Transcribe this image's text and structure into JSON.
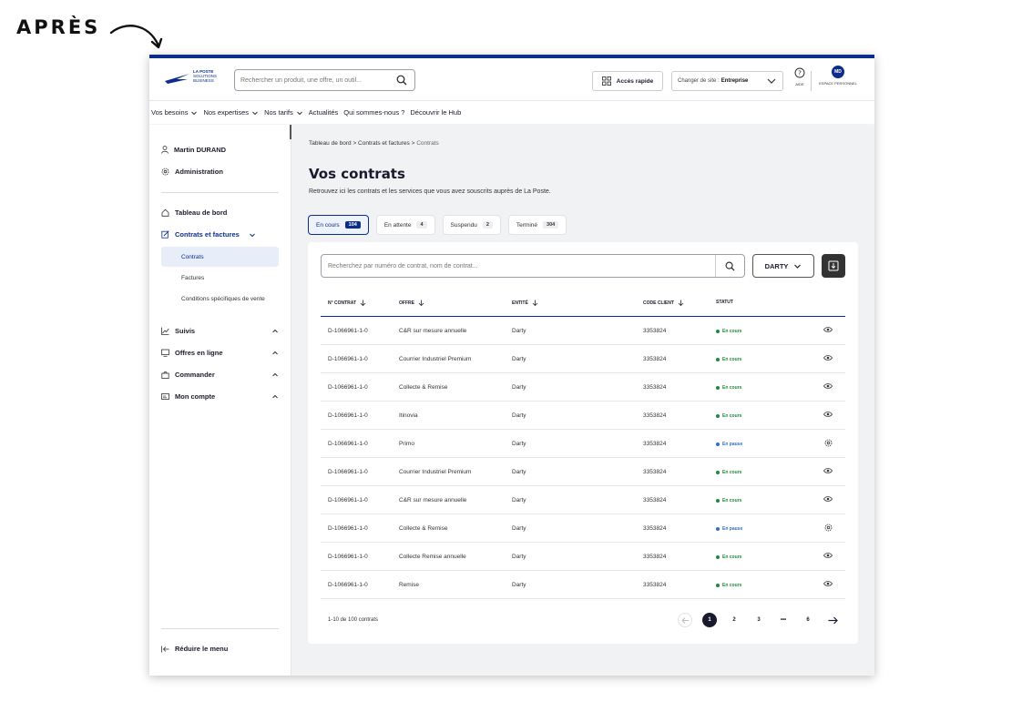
{
  "caption": "APRÈS",
  "header": {
    "logo_lines": [
      "LA POSTE",
      "SOLUTIONS",
      "BUSINESS"
    ],
    "search_placeholder": "Rechercher un produit, une offre, un outil...",
    "quick_access": "Accès rapide",
    "site_prefix": "Changer de site :",
    "site_value": "Entreprise",
    "help_label": "AIDE",
    "avatar_initials": "MD",
    "personal_space": "ESPACE PERSONNEL"
  },
  "nav": {
    "items": [
      "Vos besoins",
      "Nos expertises",
      "Nos tarifs",
      "Actualités",
      "Qui sommes-nous ?",
      "Découvrir le Hub"
    ]
  },
  "sidebar": {
    "user": "Martin DURAND",
    "admin": "Administration",
    "dashboard": "Tableau de bord",
    "contracts": "Contrats et factures",
    "sub_contracts": "Contrats",
    "sub_invoices": "Factures",
    "sub_conditions": "Conditions spécifiques de vente",
    "suivis": "Suivis",
    "offres": "Offres en ligne",
    "commander": "Commander",
    "compte": "Mon compte",
    "reduce": "Réduire le menu"
  },
  "main": {
    "breadcrumb_1": "Tableau de bord",
    "breadcrumb_2": "Contrats et factures",
    "breadcrumb_3": "Contrats",
    "title": "Vos contrats",
    "subtitle": "Retrouvez ici les contrats et les services que vous avez souscrits auprès de La Poste.",
    "tabs": [
      {
        "label": "En cours",
        "count": "104"
      },
      {
        "label": "En attente",
        "count": "4"
      },
      {
        "label": "Suspendu",
        "count": "2"
      },
      {
        "label": "Terminé",
        "count": "304"
      }
    ],
    "search_placeholder": "Recherchez par numéro de contrat, nom de contrat...",
    "filter_value": "DARTY",
    "columns": {
      "contract": "N° CONTRAT",
      "offer": "OFFRE",
      "entity": "ENTITÉ",
      "client": "CODE CLIENT",
      "status": "STATUT"
    },
    "rows": [
      {
        "contract": "D-1066961-1-0",
        "offer": "C&R sur mesure annuelle",
        "entity": "Darty",
        "client": "3353824",
        "status": "En cours"
      },
      {
        "contract": "D-1066961-1-0",
        "offer": "Courrier Industriel Premium",
        "entity": "Darty",
        "client": "3353824",
        "status": "En cours"
      },
      {
        "contract": "D-1066961-1-0",
        "offer": "Collecte & Remise",
        "entity": "Darty",
        "client": "3353824",
        "status": "En cours"
      },
      {
        "contract": "D-1066961-1-0",
        "offer": "Itinovia",
        "entity": "Darty",
        "client": "3353824",
        "status": "En cours"
      },
      {
        "contract": "D-1066961-1-0",
        "offer": "Primo",
        "entity": "Darty",
        "client": "3353824",
        "status": "En pause"
      },
      {
        "contract": "D-1066961-1-0",
        "offer": "Courrier Industriel Premium",
        "entity": "Darty",
        "client": "3353824",
        "status": "En cours"
      },
      {
        "contract": "D-1066961-1-0",
        "offer": "C&R sur mesure annuelle",
        "entity": "Darty",
        "client": "3353824",
        "status": "En cours"
      },
      {
        "contract": "D-1066961-1-0",
        "offer": "Collecte & Remise",
        "entity": "Darty",
        "client": "3353824",
        "status": "En pause"
      },
      {
        "contract": "D-1066961-1-0",
        "offer": "Collecte Remise annuelle",
        "entity": "Darty",
        "client": "3353824",
        "status": "En cours"
      },
      {
        "contract": "D-1066961-1-0",
        "offer": "Remise",
        "entity": "Darty",
        "client": "3353824",
        "status": "En cours"
      }
    ],
    "pagination_summary": "1-10 de 100 contrats",
    "pages": [
      "1",
      "2",
      "3",
      "•••",
      "6"
    ]
  },
  "colors": {
    "brand": "#0a2e8a",
    "status_active": "#1e8a3a",
    "status_paused": "#2f6fc9"
  }
}
